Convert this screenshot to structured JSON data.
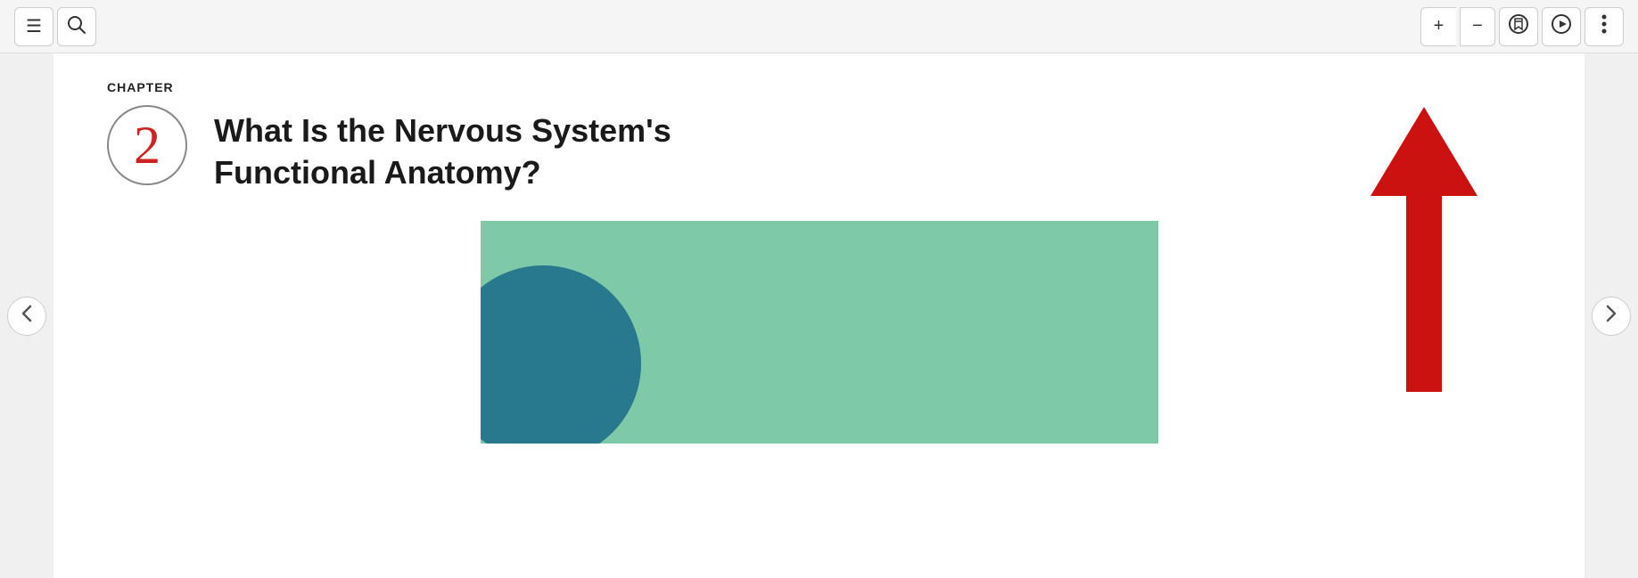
{
  "toolbar": {
    "menu_icon": "☰",
    "search_icon": "🔍",
    "zoom_plus": "+",
    "zoom_minus": "−",
    "bookmark_icon": "⊕",
    "play_icon": "▷",
    "more_icon": "⋮"
  },
  "nav": {
    "left_arrow": "❮",
    "right_arrow": "❯"
  },
  "chapter": {
    "label": "CHAPTER",
    "number": "2",
    "title": "What Is the Nervous System's Functional Anatomy?"
  }
}
